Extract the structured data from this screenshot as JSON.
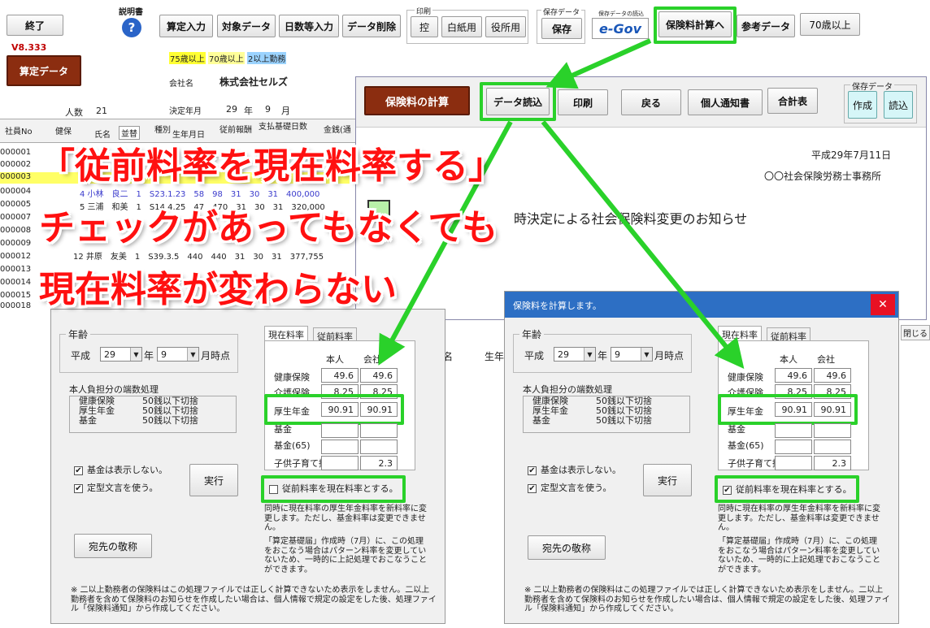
{
  "toolbar": {
    "exit": "終了",
    "help_label": "説明書",
    "version": "V8.333",
    "calc_data": "算定データ",
    "santei_input": "算定入力",
    "target_data": "対象データ",
    "days_input": "日数等入力",
    "delete_data": "データ削除",
    "print_group": "印刷",
    "print_copy": "控",
    "print_blank": "白紙用",
    "print_office": "役所用",
    "save_group": "保存データ",
    "save": "保存",
    "save_read_group": "保存データの読込",
    "egov": "e-Gov",
    "premium_calc": "保険料計算へ",
    "ref_data": "参考データ",
    "over70": "70歳以上"
  },
  "legend": {
    "a": "75歳以上",
    "b": "70歳以上",
    "c": "2以上勤務"
  },
  "company": {
    "label": "会社名",
    "name": "株式会社セルズ",
    "decision_label": "決定年月",
    "year": "29",
    "year_unit": "年",
    "month": "9",
    "month_unit": "月"
  },
  "headcount": {
    "label": "人数",
    "value": "21"
  },
  "sheet": {
    "headers": [
      "社員No",
      "健保",
      "氏名",
      "並替",
      "種別",
      "生年月日",
      "従前報酬",
      "支払基礎日数",
      "金銭(通"
    ],
    "ids": [
      "000001",
      "000002",
      "000003",
      "000004",
      "000005",
      "000007",
      "000008",
      "000009",
      "000012",
      "000013",
      "000014",
      "000015",
      "000018"
    ],
    "row_frag_4": "4 小林　良二　1　S23.1.23　58　98　31　30　31　400,000",
    "row_frag_5": "5 三浦　和美　1　S14.4.25　47　470　31　30　31　320,000",
    "row_frag_12": "12 井原　友美　1　S39.3.5　440　440　31　30　31　377,755"
  },
  "calc_window": {
    "title": "保険料の計算",
    "read_data": "データ読込",
    "print": "印刷",
    "back": "戻る",
    "personal_notice": "個人通知書",
    "total_table": "合計表",
    "save_group": "保存データ",
    "create": "作成",
    "load": "読込",
    "date": "平成29年7月11日",
    "office": "〇〇社会保険労務士事務所",
    "notice_title": "時決定による社会保険料変更のお知らせ",
    "col_a": "名",
    "col_b": "生年"
  },
  "annotation": {
    "line1": "「従前料率を現在料率する」",
    "line2": "チェックがあってもなくても",
    "line3": "現在料率が変わらない"
  },
  "dialog": {
    "title": "保険料を計算します。",
    "close_side": "閉じる",
    "age_group": "年齢",
    "era": "平成",
    "year": "29",
    "year_unit": "年",
    "month": "9",
    "month_suffix": "月時点",
    "rounding_title": "本人負担分の端数処理",
    "rounding": [
      {
        "item": "健康保険",
        "rule": "50銭以下切捨"
      },
      {
        "item": "厚生年金",
        "rule": "50銭以下切捨"
      },
      {
        "item": "基金",
        "rule": "50銭以下切捨"
      }
    ],
    "opt_hide_fund": "基金は表示しない。",
    "opt_fixed_text": "定型文言を使う。",
    "exec": "実行",
    "addressee": "宛先の敬称",
    "tab_current": "現在料率",
    "tab_prev": "従前料率",
    "col_self": "本人",
    "col_company": "会社",
    "rate_rows": [
      {
        "label": "健康保険",
        "self": "49.6",
        "company": "49.6"
      },
      {
        "label": "介護保険",
        "self": "8.25",
        "company": "8.25"
      },
      {
        "label": "厚生年金",
        "self": "90.91",
        "company": "90.91"
      },
      {
        "label": "基金",
        "self": "",
        "company": ""
      },
      {
        "label": "基金(65)",
        "self": "",
        "company": ""
      },
      {
        "label": "子供子育て拠出金",
        "self": "",
        "company": "2.3"
      }
    ],
    "prev_to_current": "従前料率を現在料率とする。",
    "note1": "同時に現在料率の厚生年金料率を新料率に変更します。ただし、基金料率は変更できません。",
    "note2": "「算定基礎届」作成時（7月）に、この処理をおこなう場合はパターン料率を変更していないため、一時的に上記処理でおこなうことができます。",
    "footnote": "※ 二以上勤務者の保険料はこの処理ファイルでは正しく計算できないため表示をしません。二以上勤務者を含めて保険料のお知らせを作成したい場合は、個人情報で規定の設定をした後、処理ファイル「保険料通知」から作成してください。"
  }
}
